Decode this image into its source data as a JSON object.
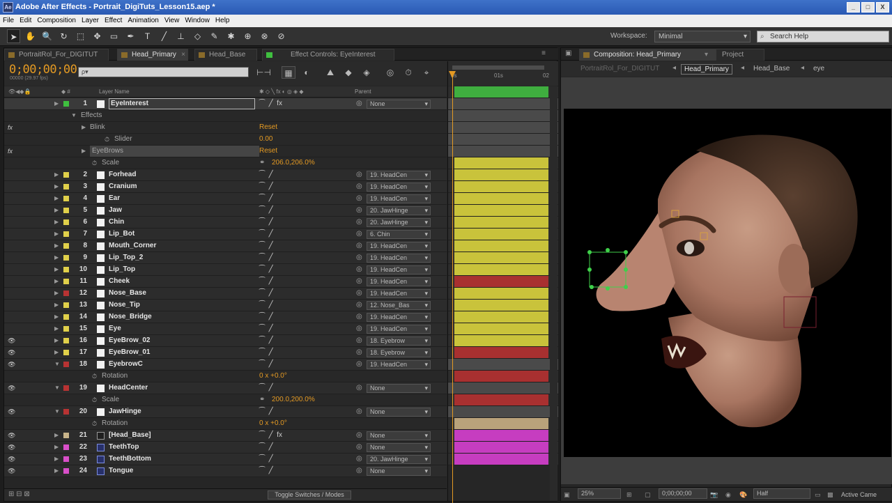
{
  "app": {
    "icon_text": "Ae",
    "title": "Adobe After Effects - Portrait_DigiTuts_Lesson15.aep *",
    "window_buttons": [
      "_",
      "□",
      "X"
    ]
  },
  "menu": [
    "File",
    "Edit",
    "Composition",
    "Layer",
    "Effect",
    "Animation",
    "View",
    "Window",
    "Help"
  ],
  "toolbar": {
    "workspace_label": "Workspace:",
    "workspace_value": "Minimal",
    "search_placeholder": "Search Help"
  },
  "timeline": {
    "tabs": [
      {
        "label": "PortraitRol_For_DIGITUT"
      },
      {
        "label": "Head_Primary",
        "active": true
      },
      {
        "label": "Head_Base"
      },
      {
        "label": "Effect Controls: EyeInterest"
      }
    ],
    "timecode": "0;00;00;00",
    "fps": "00000 (29.97 fps)",
    "search_value": "ρ▾",
    "header": {
      "layer_name": "Layer Name",
      "parent": "Parent"
    },
    "ruler": {
      "start": "0s",
      "mid": "01s",
      "end": "02"
    },
    "footer_toggle": "Toggle Switches / Modes",
    "layers": [
      {
        "id": "1",
        "name": "EyeInterest",
        "color": "#3fbf3f",
        "icon": "solid",
        "parent": "None",
        "fx": true,
        "selected": true,
        "bar": "#3fae3f",
        "eye": false
      },
      {
        "type": "group",
        "label": "Effects",
        "indent": 110
      },
      {
        "type": "fxgroup",
        "label": "Blink",
        "value": "Reset",
        "indent": 123
      },
      {
        "type": "prop",
        "label": "Slider",
        "value": "0.00",
        "indent": 158
      },
      {
        "type": "fxgroup",
        "label": "EyeBrows",
        "value": "Reset",
        "indent": 123,
        "highlight": true
      },
      {
        "type": "prop",
        "label": "Scale",
        "value": "206.0,206.0%",
        "indent": 140,
        "chain": true
      },
      {
        "id": "2",
        "name": "Forhead",
        "color": "#e0d04a",
        "icon": "solid",
        "parent": "19. HeadCen",
        "bar": "#c9c33b"
      },
      {
        "id": "3",
        "name": "Cranium",
        "color": "#e0d04a",
        "icon": "solid",
        "parent": "19. HeadCen",
        "bar": "#c9c33b"
      },
      {
        "id": "4",
        "name": "Ear",
        "color": "#e0d04a",
        "icon": "solid",
        "parent": "19. HeadCen",
        "bar": "#c9c33b"
      },
      {
        "id": "5",
        "name": "Jaw",
        "color": "#e0d04a",
        "icon": "solid",
        "parent": "20. JawHinge",
        "bar": "#c9c33b"
      },
      {
        "id": "6",
        "name": "Chin",
        "color": "#e0d04a",
        "icon": "solid",
        "parent": "20. JawHinge",
        "bar": "#c9c33b"
      },
      {
        "id": "7",
        "name": "Lip_Bot",
        "color": "#e0d04a",
        "icon": "solid",
        "parent": "6. Chin",
        "bar": "#c9c33b"
      },
      {
        "id": "8",
        "name": "Mouth_Corner",
        "color": "#e0d04a",
        "icon": "solid",
        "parent": "19. HeadCen",
        "bar": "#c9c33b"
      },
      {
        "id": "9",
        "name": "Lip_Top_2",
        "color": "#e0d04a",
        "icon": "solid",
        "parent": "19. HeadCen",
        "bar": "#c9c33b"
      },
      {
        "id": "10",
        "name": "Lip_Top",
        "color": "#e0d04a",
        "icon": "solid",
        "parent": "19. HeadCen",
        "bar": "#c9c33b"
      },
      {
        "id": "11",
        "name": "Cheek",
        "color": "#e0d04a",
        "icon": "solid",
        "parent": "19. HeadCen",
        "bar": "#c9c33b"
      },
      {
        "id": "12",
        "name": "Nose_Base",
        "color": "#b83333",
        "icon": "solid",
        "parent": "19. HeadCen",
        "bar": "#a83030"
      },
      {
        "id": "13",
        "name": "Nose_Tip",
        "color": "#e0d04a",
        "icon": "solid",
        "parent": "12. Nose_Bas",
        "bar": "#c9c33b"
      },
      {
        "id": "14",
        "name": "Nose_Bridge",
        "color": "#e0d04a",
        "icon": "solid",
        "parent": "19. HeadCen",
        "bar": "#c9c33b"
      },
      {
        "id": "15",
        "name": "Eye",
        "color": "#e0d04a",
        "icon": "solid",
        "parent": "19. HeadCen",
        "bar": "#c9c33b"
      },
      {
        "id": "16",
        "name": "EyeBrow_02",
        "color": "#e0d04a",
        "icon": "solid",
        "parent": "18. Eyebrow",
        "bar": "#c9c33b",
        "eye": true
      },
      {
        "id": "17",
        "name": "EyeBrow_01",
        "color": "#e0d04a",
        "icon": "solid",
        "parent": "18. Eyebrow",
        "bar": "#c9c33b",
        "eye": true
      },
      {
        "id": "18",
        "name": "EyebrowC",
        "color": "#b83333",
        "icon": "solid",
        "parent": "19. HeadCen",
        "bar": "#a83030",
        "eye": true,
        "open": true
      },
      {
        "type": "prop",
        "label": "Rotation",
        "value": "0 x +0.0°",
        "indent": 140
      },
      {
        "id": "19",
        "name": "HeadCenter",
        "color": "#b83333",
        "icon": "solid",
        "parent": "None",
        "bar": "#a83030",
        "eye": true,
        "open": true
      },
      {
        "type": "prop",
        "label": "Scale",
        "value": "200.0,200.0%",
        "indent": 140,
        "chain": true
      },
      {
        "id": "20",
        "name": "JawHinge",
        "color": "#b83333",
        "icon": "solid",
        "parent": "None",
        "bar": "#a83030",
        "eye": true,
        "open": true
      },
      {
        "type": "prop",
        "label": "Rotation",
        "value": "0 x +0.0°",
        "indent": 140
      },
      {
        "id": "21",
        "name": "[Head_Base]",
        "color": "#c8b48a",
        "icon": "precomp",
        "parent": "None",
        "bar": "#b9a27b",
        "eye": true,
        "fx": true
      },
      {
        "id": "22",
        "name": "TeethTop",
        "color": "#d94fc9",
        "icon": "comp",
        "parent": "None",
        "bar": "#c63dc0",
        "eye": true
      },
      {
        "id": "23",
        "name": "TeethBottom",
        "color": "#d94fc9",
        "icon": "comp",
        "parent": "20. JawHinge",
        "bar": "#c63dc0",
        "eye": true
      },
      {
        "id": "24",
        "name": "Tongue",
        "color": "#d94fc9",
        "icon": "comp",
        "parent": "None",
        "bar": "#c63dc0",
        "eye": true
      }
    ]
  },
  "composition": {
    "tabs": [
      {
        "label": "Composition: Head_Primary",
        "active": true
      },
      {
        "label": "Project"
      }
    ],
    "breadcrumbs": [
      "PortraitRol_For_DIGITUT",
      "Head_Primary",
      "Head_Base",
      "eye"
    ],
    "footer": {
      "zoom": "25%",
      "timecode": "0;00;00;00",
      "resolution": "Half",
      "camera": "Active Came"
    }
  },
  "colors": {
    "accent": "#e49a23",
    "selection": "#3fbf3f"
  }
}
